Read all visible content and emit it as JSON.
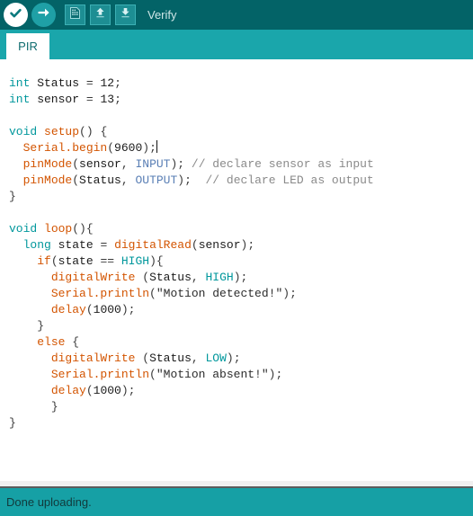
{
  "toolbar": {
    "verify_label": "Verify",
    "buttons": [
      {
        "name": "verify",
        "icon": "checkmark-icon",
        "tooltip": "Verify"
      },
      {
        "name": "upload",
        "icon": "right-arrow-icon",
        "tooltip": "Upload"
      },
      {
        "name": "new",
        "icon": "new-document-icon",
        "tooltip": "New"
      },
      {
        "name": "open",
        "icon": "up-arrow-icon",
        "tooltip": "Open"
      },
      {
        "name": "save",
        "icon": "down-arrow-icon",
        "tooltip": "Save"
      }
    ],
    "colors": {
      "background": "#036367",
      "verify_circle": "#ffffff",
      "upload_circle": "#1fa0a6",
      "square_button": "#1d8e93",
      "label_text": "#cfe6e7"
    }
  },
  "tabs": {
    "items": [
      {
        "label": "PIR",
        "active": true
      }
    ],
    "colors": {
      "bar_background": "#1aa6ab",
      "active_tab_background": "#ffffff",
      "active_tab_text": "#0d6b6e"
    }
  },
  "editor": {
    "background": "#ffffff",
    "syntax_colors": {
      "keyword": "#00979c",
      "function": "#d35400",
      "constant": "#5a7fb5",
      "comment": "#8a8a8a",
      "string": "#2c2c2c",
      "plain": "#1a1a1a"
    },
    "cursor_line": 6,
    "lines": [
      "int Status = 12;",
      "int sensor = 13;",
      "",
      "void setup() {",
      "  Serial.begin(9600);",
      "  pinMode(sensor, INPUT); // declare sensor as input",
      "  pinMode(Status, OUTPUT);  // declare LED as output",
      "}",
      "",
      "void loop(){",
      "  long state = digitalRead(sensor);",
      "    if(state == HIGH){",
      "      digitalWrite (Status, HIGH);",
      "      Serial.println(\"Motion detected!\");",
      "      delay(1000);",
      "    }",
      "    else {",
      "      digitalWrite (Status, LOW);",
      "      Serial.println(\"Motion absent!\");",
      "      delay(1000);",
      "      }",
      "}"
    ]
  },
  "statusbar": {
    "message": "Done uploading.",
    "colors": {
      "background": "#16a0a5",
      "text": "#12393b"
    }
  }
}
